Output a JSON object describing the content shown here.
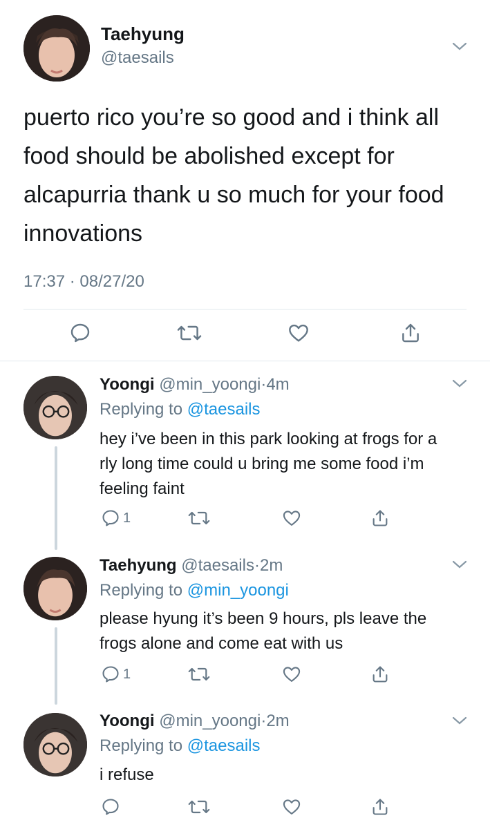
{
  "main_tweet": {
    "name": "Taehyung",
    "handle": "@taesails",
    "text": "puerto rico you’re so good and i think all food should be abolished except for alcapurria thank u so much for your food innovations",
    "time": "17:37",
    "sep": "·",
    "date": "08/27/20"
  },
  "replies": [
    {
      "name": "Yoongi",
      "handle": "@min_yoongi",
      "sep": "·",
      "time": "4m",
      "replying_prefix": "Replying to",
      "replying_to": "@taesails",
      "text": "hey i’ve been in this park looking at frogs for a rly long time could u bring me some food i’m feeling faint",
      "reply_count": "1"
    },
    {
      "name": "Taehyung",
      "handle": "@taesails",
      "sep": "·",
      "time": "2m",
      "replying_prefix": "Replying to",
      "replying_to": "@min_yoongi",
      "text": "please hyung it’s been 9 hours, pls leave the frogs alone and come eat with us",
      "reply_count": "1"
    },
    {
      "name": "Yoongi",
      "handle": "@min_yoongi",
      "sep": "·",
      "time": "2m",
      "replying_prefix": "Replying to",
      "replying_to": "@taesails",
      "text": "i refuse",
      "reply_count": ""
    }
  ],
  "icons": {
    "reply": "reply-bubble-icon",
    "retweet": "retweet-icon",
    "like": "heart-icon",
    "share": "share-icon",
    "menu": "chevron-down-icon"
  },
  "colors": {
    "text": "#14171a",
    "muted": "#657786",
    "link": "#1b95e0",
    "divider": "#e6ecf0"
  }
}
